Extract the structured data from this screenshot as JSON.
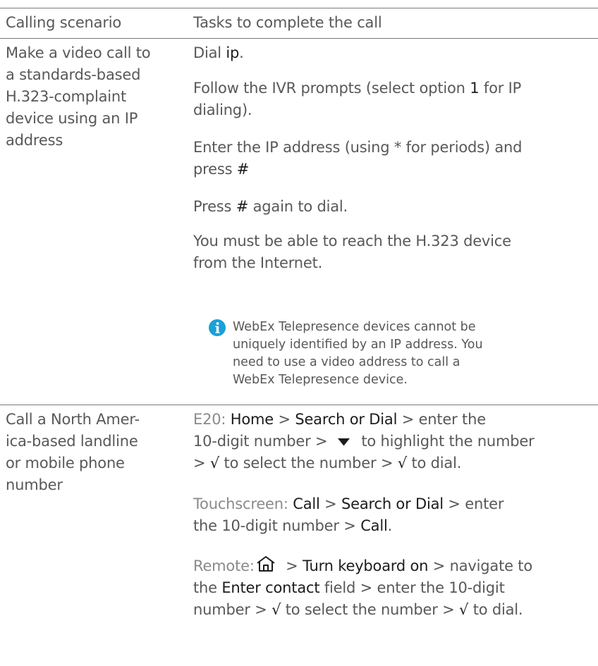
{
  "table": {
    "header": {
      "col1": "Calling scenario",
      "col2": "Tasks to complete the call"
    },
    "row1": {
      "scenario": [
        "Make a video call to",
        "a standards-based",
        "H.323-complaint",
        "device using an IP",
        "address"
      ],
      "dial_pre": "Dial ",
      "dial_key": "ip",
      "dial_post": ".",
      "ivr_l1_pre": "Follow the IVR prompts (select option ",
      "ivr_l1_key": "1",
      "ivr_l1_post": " for IP",
      "ivr_l2": "dialing).",
      "ip_l1": "Enter the IP address (using * for periods) and",
      "ip_l2_pre": "press ",
      "ip_l2_key": "#",
      "press_pre": "Press ",
      "press_key": "#",
      "press_post": " again to dial.",
      "reach_l1": "You must be able to reach the H.323 device",
      "reach_l2": "from the Internet.",
      "note": [
        "WebEx Telepresence devices cannot be",
        "uniquely identified by an IP address. You",
        "need to use a video address to call a",
        "WebEx Telepresence device."
      ]
    },
    "row2": {
      "scenario": [
        "Call a North Amer-",
        "ica-based landline",
        "or mobile phone",
        "number"
      ],
      "e20": {
        "label": "E20:",
        "home": "Home",
        "sep": " > ",
        "search": "Search or Dial",
        "l1_post": " > enter the",
        "l2_pre": "10-digit number > ",
        "l2_post": " to highlight the number",
        "l3_pre": "> ",
        "check": "√",
        "l3_mid": " to select the number > ",
        "l3_post": " to dial."
      },
      "touch": {
        "label": "Touchscreen:",
        "call": "Call",
        "sep": " > ",
        "search": "Search or Dial",
        "l1_post": " > enter",
        "l2_pre": "the 10-digit number > ",
        "l2_key": "Call",
        "l2_post": "."
      },
      "remote": {
        "label": "Remote:",
        "sep": " > ",
        "kbd": "Turn keyboard on",
        "l1_post": " > navigate to",
        "l2_pre": "the ",
        "contact": "Enter contact",
        "l2_post": " field > enter the 10-digit",
        "l3_pre": "number > ",
        "check": "√",
        "l3_mid": " to select the number > ",
        "l3_post": " to dial."
      }
    }
  },
  "icons": {
    "info": "info-icon",
    "down": "triangle-down-icon",
    "home": "home-icon"
  },
  "colors": {
    "text": "#58585a",
    "emphasis": "#1c1c1c",
    "label": "#8a8a8c",
    "info": "#1ba0d7",
    "rule": "#7a7a7a"
  }
}
